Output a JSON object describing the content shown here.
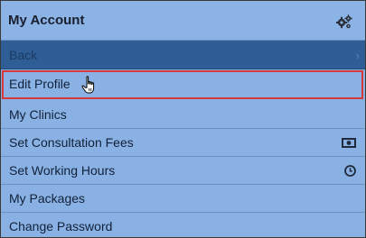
{
  "header": {
    "title": "My Account",
    "settings_icon": "gears-icon"
  },
  "menu": {
    "back_label": "Back",
    "back_icon": "chevron-right-icon",
    "items": [
      {
        "label": "Edit Profile",
        "icon": "",
        "highlighted": true
      },
      {
        "label": "My Clinics",
        "icon": ""
      },
      {
        "label": "Set Consultation Fees",
        "icon": "money-icon"
      },
      {
        "label": "Set Working Hours",
        "icon": "clock-icon"
      },
      {
        "label": "My Packages",
        "icon": ""
      },
      {
        "label": "Change Password",
        "icon": ""
      }
    ]
  },
  "colors": {
    "panel_bg": "#89b1e3",
    "back_bg": "#2f5d95",
    "highlight_border": "#d9383a"
  }
}
